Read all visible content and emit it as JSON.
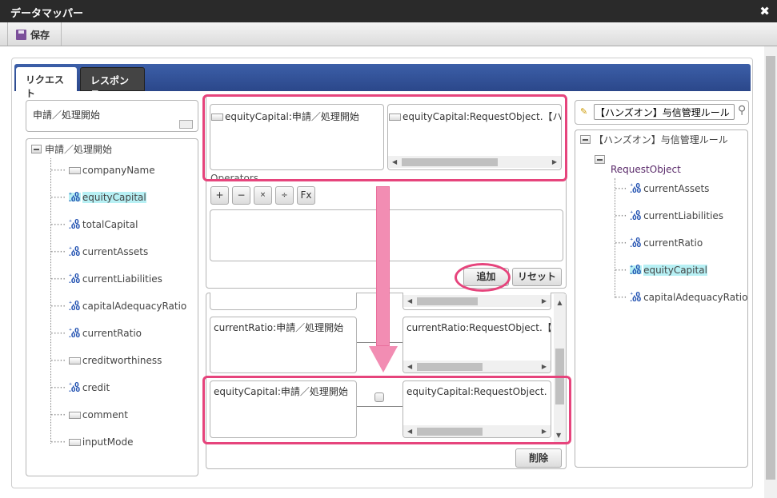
{
  "window": {
    "title": "データマッパー",
    "close_icon": "close-icon"
  },
  "toolbar": {
    "save_label": "保存"
  },
  "tabs": [
    {
      "label": "リクエスト",
      "active": true
    },
    {
      "label": "レスポンス",
      "active": false
    }
  ],
  "left": {
    "header": "申請／処理開始",
    "tree_root": "申請／処理開始",
    "items": [
      {
        "label": "companyName",
        "icon": "text"
      },
      {
        "label": "equityCapital",
        "icon": "number",
        "selected": true
      },
      {
        "label": "totalCapital",
        "icon": "number"
      },
      {
        "label": "currentAssets",
        "icon": "number"
      },
      {
        "label": "currentLiabilities",
        "icon": "number"
      },
      {
        "label": "capitalAdequacyRatio",
        "icon": "number"
      },
      {
        "label": "currentRatio",
        "icon": "number"
      },
      {
        "label": "creditworthiness",
        "icon": "text"
      },
      {
        "label": "credit",
        "icon": "number"
      },
      {
        "label": "comment",
        "icon": "text"
      },
      {
        "label": "inputMode",
        "icon": "text"
      }
    ]
  },
  "middle": {
    "source_field": "equityCapital:申請／処理開始",
    "target_field": "equityCapital:RequestObject.【ハンズオン】",
    "operators_label": "Operators",
    "operators": [
      "+",
      "−",
      "×",
      "÷",
      "Fx"
    ],
    "add_label": "追加",
    "reset_label": "リセット",
    "mappings": [
      {
        "source": "currentRatio:申請／処理開始",
        "target": "currentRatio:RequestObject.【ハ"
      },
      {
        "source": "equityCapital:申請／処理開始",
        "target": "equityCapital:RequestObject.【ハ"
      }
    ],
    "delete_label": "削除"
  },
  "right": {
    "search_value": "【ハンズオン】与信管理ルール",
    "tree_root": "【ハンズオン】与信管理ルール",
    "object": "RequestObject",
    "items": [
      {
        "label": "currentAssets"
      },
      {
        "label": "currentLiabilities"
      },
      {
        "label": "currentRatio"
      },
      {
        "label": "equityCapital",
        "selected": true
      },
      {
        "label": "capitalAdequacyRatio"
      }
    ]
  },
  "colors": {
    "highlight": "#e6447c",
    "tab_bar": "#34559c",
    "selected": "#b7f0f4"
  }
}
